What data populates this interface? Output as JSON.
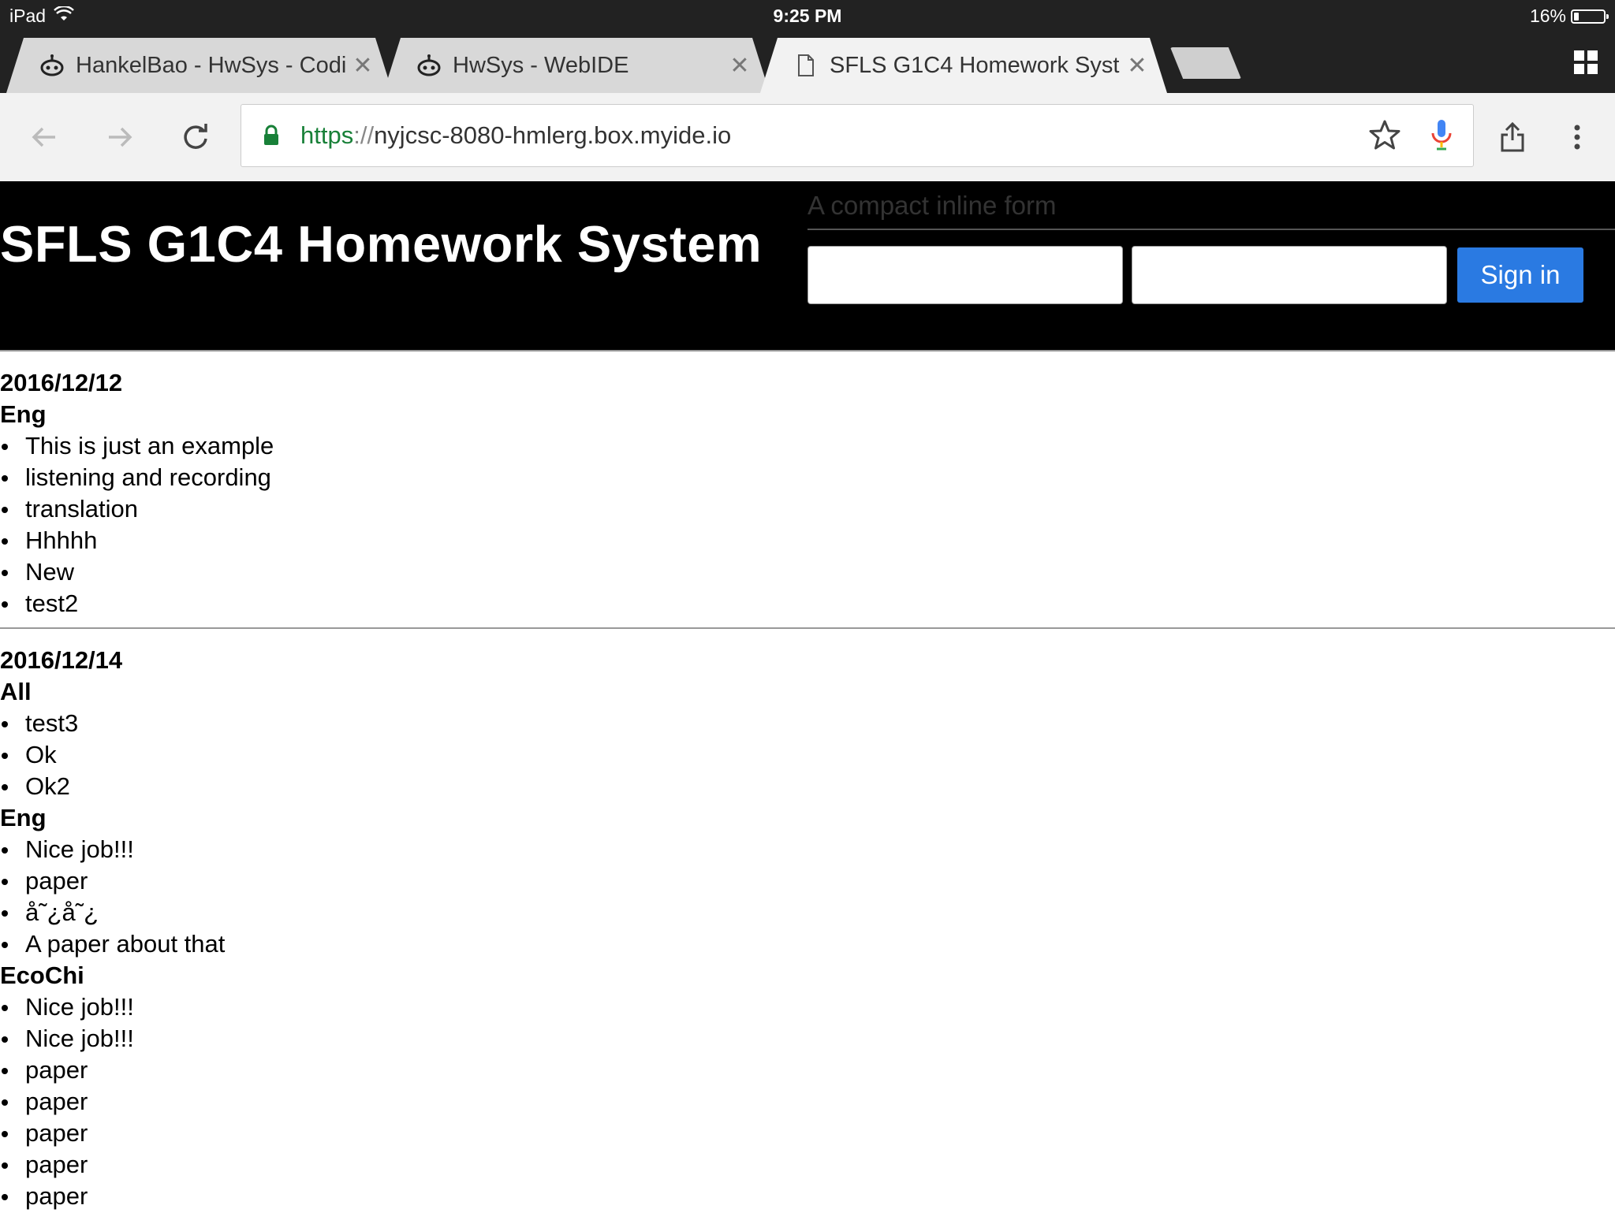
{
  "status_bar": {
    "device": "iPad",
    "time": "9:25 PM",
    "battery": "16%",
    "battery_level": 0.16
  },
  "tabs": [
    {
      "title": "HankelBao - HwSys - Coding",
      "icon": "bot-icon",
      "active": false
    },
    {
      "title": "HwSys - WebIDE",
      "icon": "bot-icon",
      "active": false
    },
    {
      "title": "SFLS G1C4 Homework Syst",
      "icon": "page-icon",
      "active": true
    }
  ],
  "omnibox": {
    "scheme": "https",
    "separator": "://",
    "host": "nyjcsc-8080-hmlerg.box.myide.io"
  },
  "header": {
    "title": "SFLS G1C4 Homework System",
    "form_legend": "A compact inline form",
    "field1_value": "",
    "field2_value": "",
    "signin_label": "Sign in"
  },
  "sections": [
    {
      "date": "2016/12/12",
      "groups": [
        {
          "subject": "Eng",
          "items": [
            "This is just an example",
            "listening and recording",
            "translation",
            "Hhhhh",
            "New",
            "test2"
          ]
        }
      ]
    },
    {
      "date": "2016/12/14",
      "groups": [
        {
          "subject": "All",
          "items": [
            "test3",
            "Ok",
            "Ok2"
          ]
        },
        {
          "subject": "Eng",
          "items": [
            "Nice job!!!",
            "paper",
            "å˜¿å˜¿",
            "A paper about that"
          ]
        },
        {
          "subject": "EcoChi",
          "items": [
            "Nice job!!!",
            "Nice job!!!",
            "paper",
            "paper",
            "paper",
            "paper",
            "paper"
          ]
        }
      ]
    }
  ],
  "colors": {
    "signin": "#2a7ae2",
    "secure": "#188038",
    "header_bg": "#000000"
  }
}
